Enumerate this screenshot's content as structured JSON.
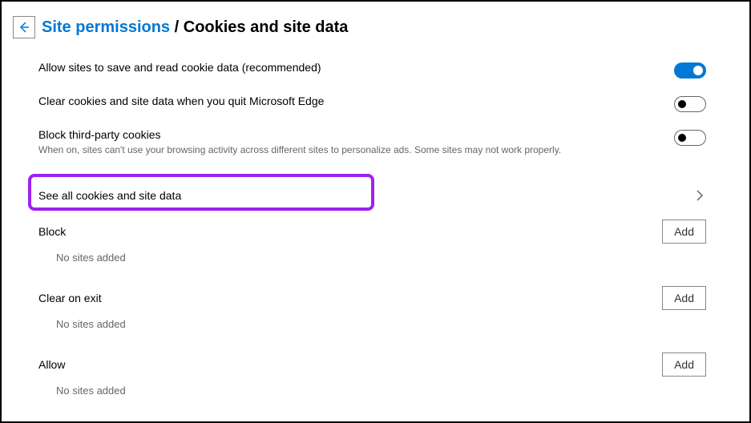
{
  "breadcrumb": {
    "parent": "Site permissions",
    "separator": "/",
    "current": "Cookies and site data"
  },
  "settings": {
    "allow_cookies": {
      "title": "Allow sites to save and read cookie data (recommended)",
      "enabled": true
    },
    "clear_on_quit": {
      "title": "Clear cookies and site data when you quit Microsoft Edge",
      "enabled": false
    },
    "block_third_party": {
      "title": "Block third-party cookies",
      "description": "When on, sites can't use your browsing activity across different sites to personalize ads. Some sites may not work properly.",
      "enabled": false
    }
  },
  "see_all": {
    "label": "See all cookies and site data"
  },
  "sections": {
    "block": {
      "title": "Block",
      "add_label": "Add",
      "empty": "No sites added"
    },
    "clear_on_exit": {
      "title": "Clear on exit",
      "add_label": "Add",
      "empty": "No sites added"
    },
    "allow": {
      "title": "Allow",
      "add_label": "Add",
      "empty": "No sites added"
    }
  }
}
